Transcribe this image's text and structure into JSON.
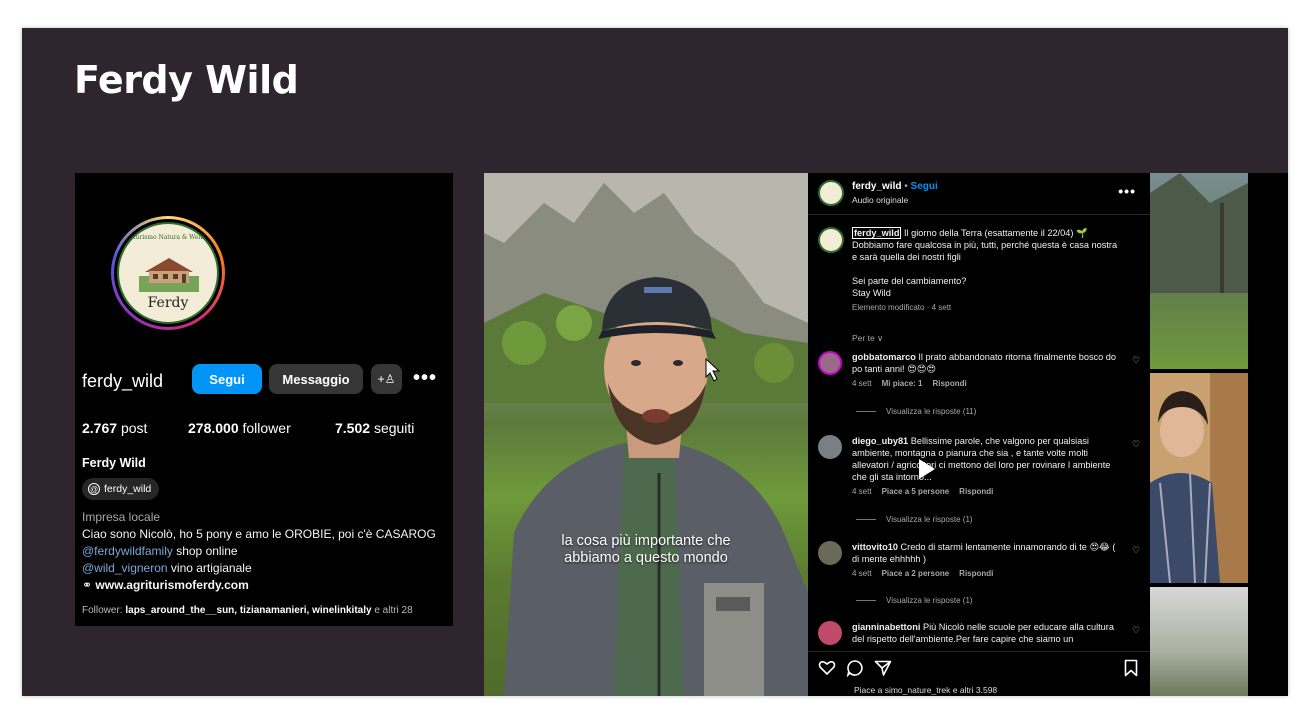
{
  "slide": {
    "title": "Ferdy Wild"
  },
  "profile": {
    "username": "ferdy_wild",
    "logo": {
      "arc_text": "Agriturismo Natura & Wellness",
      "word": "Ferdy"
    },
    "buttons": {
      "follow": "Segui",
      "message": "Messaggio",
      "add_person": "+♙",
      "more": "•••"
    },
    "stats": [
      {
        "value": "2.767",
        "label": "post"
      },
      {
        "value": "278.000",
        "label": "follower"
      },
      {
        "value": "7.502",
        "label": "seguiti"
      }
    ],
    "display_name": "Ferdy Wild",
    "threads_handle": "ferdy_wild",
    "threads_glyph": "@",
    "category": "Impresa locale",
    "bio_line1": "Ciao sono Nicolò, ho 5 pony e amo le OROBIE, poi c'è CASAROG",
    "bio_mention1": "@ferdywildfamily",
    "bio_mention1_rest": " shop online",
    "bio_mention2": "@wild_vigneron",
    "bio_mention2_rest": " vino artigianale",
    "link_glyph": "⚭",
    "website": "www.agriturismoferdy.com",
    "followers_prefix": "Follower: ",
    "followers_names": "laps_around_the__sun, tizianamanieri, winelinkitaly",
    "followers_suffix": " e altri 28"
  },
  "video": {
    "subtitle_line1": "la cosa più importante che",
    "subtitle_line2": "abbiamo a questo mondo"
  },
  "post": {
    "header": {
      "username": "ferdy_wild",
      "dot": " • ",
      "follow": "Segui",
      "audio": "Audio originale",
      "more": "•••"
    },
    "caption": {
      "username": "ferdy_wild",
      "line1": " Il giorno della Terra (esattamente il 22/04) 🌱",
      "line2": "Dobbiamo fare qualcosa in più, tutti, perché questa è casa nostra",
      "line3": "e sarà quella dei nostri figli",
      "line4": "Sei parte del cambiamento?",
      "line5": "Stay Wild",
      "meta": "Elemento modificato · 4 sett"
    },
    "filter_label": "Per te ∨",
    "comments": [
      {
        "user": "gobbatomarco",
        "text": " Il prato abbandonato ritorna finalmente bosco do po tanti anni! 😍😍😍",
        "time": "4 sett",
        "likes": "Mi piace: 1",
        "reply": "Rispondi",
        "replies": "Visualizza le risposte (11)"
      },
      {
        "user": "diego_uby81",
        "text": " Bellissime parole, che valgono per qualsiasi ambiente, montagna o pianura che sia , e tante volte molti allevatori / agricoltori ci mettono del loro per rovinare l ambiente che gli sta intorno...",
        "time": "4 sett",
        "likes": "Piace a 5 persone",
        "reply": "Rispondi",
        "replies": "Visualizza le risposte (1)"
      },
      {
        "user": "vittovito10",
        "text": " Credo di starmi lentamente innamorando di te 😍😂 ( di mente ehhhhh )",
        "time": "4 sett",
        "likes": "Piace a 2 persone",
        "reply": "Rispondi",
        "replies": "Visualizza le risposte (1)"
      },
      {
        "user": "gianninabettoni",
        "text": " Più Nicolò nelle scuole per educare alla cultura del rispetto dell'ambiente.Per fare capire che siamo un",
        "time": "",
        "likes": "",
        "reply": "",
        "replies": ""
      }
    ],
    "likes_line": "Piace a simo_nature_trek e altri 3.598",
    "icons": [
      "heart-icon",
      "comment-icon",
      "share-icon",
      "bookmark-icon"
    ]
  },
  "colors": {
    "accent": "#0095f6",
    "slide_bg": "#2e252e",
    "panel_bg": "#000000",
    "secondary_button": "#363636"
  }
}
